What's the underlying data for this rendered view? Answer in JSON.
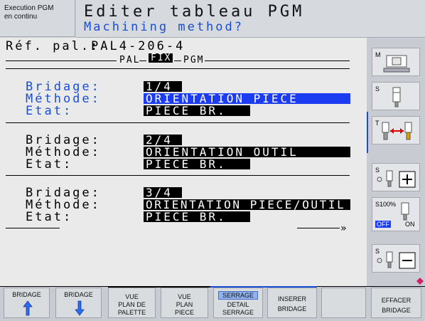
{
  "header": {
    "mode_line1": "Execution PGM",
    "mode_line2": "en continu",
    "title": "Editer tableau PGM",
    "subtitle": "Machining method?"
  },
  "main": {
    "ref_label": "Réf. pal.:",
    "ref_value": "PAL4-206-4",
    "tabs": [
      "PAL",
      "FIX",
      "PGM"
    ],
    "entries": [
      {
        "bridage_label": "Bridage:",
        "bridage_value": "1/4",
        "methode_label": "Méthode:",
        "methode_value": "ORIENTATION PIECE",
        "etat_label": "Etat:",
        "etat_value": "PIECE BR."
      },
      {
        "bridage_label": "Bridage:",
        "bridage_value": "2/4",
        "methode_label": "Méthode:",
        "methode_value": "ORIENTATION OUTIL",
        "etat_label": "Etat:",
        "etat_value": "PIECE BR."
      },
      {
        "bridage_label": "Bridage:",
        "bridage_value": "3/4",
        "methode_label": "Méthode:",
        "methode_value": "ORIENTATION PIECE/OUTIL",
        "etat_label": "Etat:",
        "etat_value": "PIECE BR."
      }
    ],
    "more_indicator": "»"
  },
  "side": {
    "buttons": [
      {
        "label": "M"
      },
      {
        "label": "S"
      },
      {
        "label": "T"
      },
      {
        "label": "S"
      },
      {
        "label": "S100%",
        "off": "OFF",
        "on": "ON"
      },
      {
        "label": "S"
      }
    ]
  },
  "softkeys": [
    {
      "l1": "BRIDAGE",
      "l2": "",
      "l3": ""
    },
    {
      "l1": "BRIDAGE",
      "l2": "",
      "l3": ""
    },
    {
      "l1": "VUE",
      "l2": "PLAN DE",
      "l3": "PALETTE"
    },
    {
      "l1": "VUE",
      "l2": "PLAN",
      "l3": "PIECE"
    },
    {
      "l1": "SERRAGE",
      "l2": "DETAIL",
      "l3": "SERRAGE"
    },
    {
      "l1": "INSERER",
      "l2": "BRIDAGE",
      "l3": ""
    },
    {
      "l1": "",
      "l2": "",
      "l3": ""
    },
    {
      "l1": "EFFACER",
      "l2": "BRIDAGE",
      "l3": ""
    }
  ],
  "colors": {
    "accent": "#1a4dd6",
    "selection": "#1b3cf0",
    "field_bg": "#000000",
    "screen_bg": "#eaeaea",
    "chrome_bg": "#c8ccd2"
  }
}
